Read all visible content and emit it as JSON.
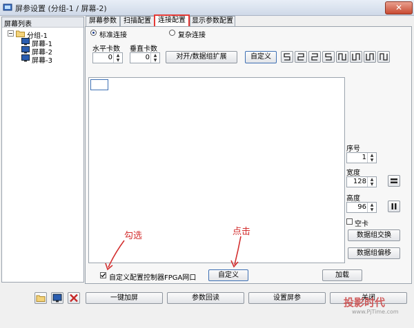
{
  "window": {
    "title": "屏参设置  (分组-1 / 屏幕-2)",
    "close_label": "✕"
  },
  "tree": {
    "header": "屏幕列表",
    "group": "分组-1",
    "screens": [
      "屏幕-1",
      "屏幕-2",
      "屏幕-3"
    ]
  },
  "tabs": [
    "屏幕参数",
    "扫描配置",
    "连接配置",
    "显示参数配置"
  ],
  "connection": {
    "standard_label": "标准连接",
    "complex_label": "复杂连接",
    "h_cards_label": "水平卡数",
    "h_cards_value": "0",
    "v_cards_label": "垂直卡数",
    "v_cards_value": "0",
    "expand_label": "对开/数据组扩展",
    "custom_label": "自定义"
  },
  "properties": {
    "index_label": "序号",
    "index_value": "1",
    "width_label": "宽度",
    "width_value": "128",
    "height_label": "高度",
    "height_value": "96",
    "empty_card_label": "空卡",
    "swap_label": "数据组交换",
    "offset_label": "数据组偏移"
  },
  "fpga": {
    "checkbox_label": "自定义配置控制器FPGA网口",
    "custom_label": "自定义",
    "load_label": "加载"
  },
  "annotations": {
    "check_hint": "勾选",
    "click_hint": "点击"
  },
  "bottom": {
    "one_key_label": "一键加屏",
    "readback_label": "参数回读",
    "set_label": "设置屏参",
    "close_label": "关闭"
  },
  "watermark": {
    "main": "投影时代",
    "sub": "www.PjTime.com"
  },
  "colors": {
    "highlight": "#e53935",
    "annotation": "#d32f2f",
    "accent": "#3d6fb3"
  }
}
